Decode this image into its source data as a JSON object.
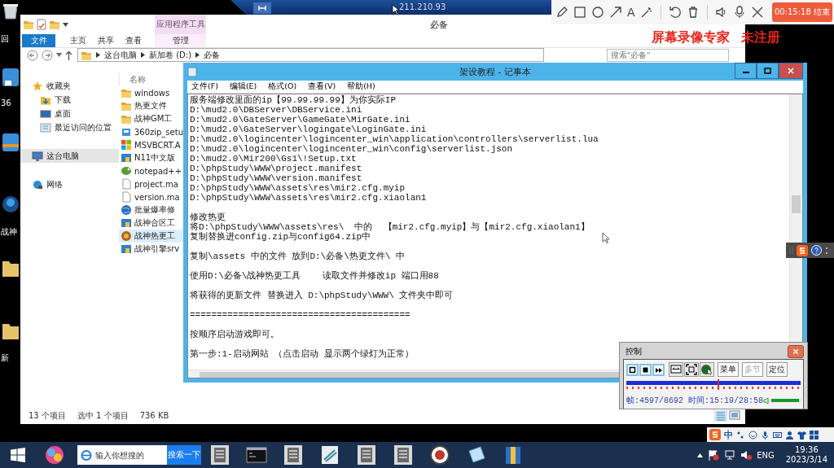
{
  "desktop": {
    "icons": [
      {
        "kind": "bin",
        "label": "回"
      },
      {
        "kind": "app",
        "label": "36"
      },
      {
        "kind": "app2"
      },
      {
        "kind": "ball",
        "label": "战神"
      },
      {
        "kind": "folder"
      },
      {
        "kind": "folder",
        "label": "新"
      }
    ]
  },
  "remote_bar": {
    "address": "211.210.93"
  },
  "recorder_toolbar": {
    "tool_groups": [
      [
        {
          "kind": "pencil"
        },
        {
          "kind": "rectangle"
        },
        {
          "kind": "circle"
        },
        {
          "kind": "arrow"
        },
        {
          "kind": "text",
          "glyph": "A"
        },
        {
          "kind": "wand"
        }
      ],
      [
        {
          "kind": "undo"
        },
        {
          "kind": "delete"
        }
      ],
      [
        {
          "kind": "speaker"
        },
        {
          "kind": "mic"
        },
        {
          "kind": "close"
        }
      ]
    ],
    "timer": "00:15:18 结束"
  },
  "recorder_banner": {
    "product": "屏幕录像专家",
    "status": "未注册"
  },
  "explorer": {
    "context_tab": "应用程序工具",
    "title": "必备",
    "ribbon_tabs": [
      {
        "label": "文件",
        "kind": "file"
      },
      {
        "label": "主页",
        "kind": "tab"
      },
      {
        "label": "共享",
        "kind": "tab"
      },
      {
        "label": "查看",
        "kind": "tab"
      },
      {
        "label": "管理",
        "kind": "context"
      }
    ],
    "path": [
      "这台电脑",
      "新加卷 (D:)",
      "必备"
    ],
    "search_placeholder": "搜索\"必备\"",
    "nav": [
      {
        "label": "收藏夹",
        "kind": "star",
        "selected": false,
        "children": [
          {
            "label": "下载",
            "kind": "download",
            "selected": false
          },
          {
            "label": "桌面",
            "kind": "desktop",
            "selected": false
          },
          {
            "label": "最近访问的位置",
            "kind": "recent",
            "selected": false
          }
        ]
      },
      {
        "label": "这台电脑",
        "kind": "pc",
        "selected": true
      },
      {
        "label": "网络",
        "kind": "network",
        "selected": false
      }
    ],
    "column": "名称",
    "files": [
      {
        "name": "windows",
        "kind": "folder",
        "selected": false
      },
      {
        "name": "热更文件",
        "kind": "folder",
        "selected": false
      },
      {
        "name": "战神GM工",
        "kind": "folder",
        "selected": false
      },
      {
        "name": "360zip_setu",
        "kind": "installer",
        "selected": false
      },
      {
        "name": "MSVBCRT.A",
        "kind": "tiles",
        "selected": false
      },
      {
        "name": "N11中文版",
        "kind": "tool",
        "selected": false
      },
      {
        "name": "notepad++",
        "kind": "lizard",
        "selected": false
      },
      {
        "name": "project.ma",
        "kind": "page",
        "selected": false
      },
      {
        "name": "version.ma",
        "kind": "page",
        "selected": false
      },
      {
        "name": "批量爆率修",
        "kind": "globe",
        "selected": false
      },
      {
        "name": "战神合区工",
        "kind": "tool",
        "selected": false
      },
      {
        "name": "战神热更工",
        "kind": "game",
        "selected": true
      },
      {
        "name": "战神引擎srv",
        "kind": "tool",
        "selected": false
      }
    ],
    "status": {
      "count": "13 个项目",
      "selection": "选中 1 个项目",
      "size": "736 KB"
    }
  },
  "notepad": {
    "title": "架设教程 - 记事本",
    "menu": [
      "文件(F)",
      "编辑(E)",
      "格式(O)",
      "查看(V)",
      "帮助(H)"
    ],
    "blocks": [
      {
        "lines": [
          "服务端修改里面的ip【99.99.99.99】为你实际IP",
          "D:\\mud2.0\\DBServer\\DBService.ini",
          "D:\\mud2.0\\GateServer\\GameGate\\MirGate.ini",
          "D:\\mud2.0\\GateServer\\logingate\\LoginGate.ini",
          "D:\\mud2.0\\logincenter\\logincenter_win\\application\\controllers\\serverlist.lua",
          "D:\\mud2.0\\logincenter\\logincenter_win\\config\\serverlist.json",
          "D:\\mud2.0\\Mir200\\Gs1\\!Setup.txt",
          "D:\\phpStudy\\WWW\\project.manifest",
          "D:\\phpStudy\\WWW\\version.manifest",
          "D:\\phpStudy\\WWW\\assets\\res\\mir2.cfg.myip",
          "D:\\phpStudy\\WWW\\assets\\res\\mir2.cfg.xiaolan1"
        ]
      },
      {
        "lines": [
          "修改热更",
          "将D:\\phpStudy\\WWW\\assets\\res\\  中的  【mir2.cfg.myip】与【mir2.cfg.xiaolan1】",
          "复制替换进config.zip与config64.zip中"
        ]
      },
      {
        "lines": [
          "复制\\assets 中的文件 放到D:\\必备\\热更文件\\ 中"
        ]
      },
      {
        "lines": [
          "使用D:\\必备\\战神热更工具    读取文件并修改ip 端口用88"
        ]
      },
      {
        "lines": [
          "将获得的更新文件 替换进入 D:\\phpStudy\\WWW\\ 文件夹中即可"
        ]
      },
      {
        "lines": [
          "========================================="
        ]
      },
      {
        "lines": [
          "按顺序启动游戏即可。"
        ]
      },
      {
        "lines": [
          "第一步:1-启动网站 （点击启动 显示两个绿灯为正常）"
        ]
      }
    ]
  },
  "player_control": {
    "title": "控制",
    "buttons": [
      {
        "kind": "square"
      },
      {
        "kind": "square"
      },
      {
        "kind": "square"
      },
      {
        "kind": "toggle"
      },
      {
        "kind": "toggle"
      },
      {
        "kind": "toggle"
      },
      {
        "kind": "text",
        "label": "菜单",
        "disabled": false
      },
      {
        "kind": "text",
        "label": "多节",
        "disabled": true
      },
      {
        "kind": "text",
        "label": "定位",
        "disabled": false
      }
    ],
    "progress": {
      "level": 0.53
    },
    "status": "帧:4597/8692 时间:15:19/28:58",
    "volume": {
      "level": 0.95
    }
  },
  "ime_bar": {
    "mode": "中"
  },
  "taskbar": {
    "search": {
      "placeholder": "输入你想搜的",
      "button": "搜索一下"
    },
    "pinned": [
      {
        "kind": "colorball"
      },
      {
        "kind": "tile"
      },
      {
        "kind": "terminal"
      },
      {
        "kind": "tile"
      },
      {
        "kind": "scroll"
      },
      {
        "kind": "tile"
      },
      {
        "kind": "tile"
      },
      {
        "kind": "seal"
      },
      {
        "kind": "notepad"
      },
      {
        "kind": "archive"
      }
    ],
    "tray": {
      "language": "ENG",
      "time": "19:36",
      "date": "2023/3/14"
    }
  }
}
